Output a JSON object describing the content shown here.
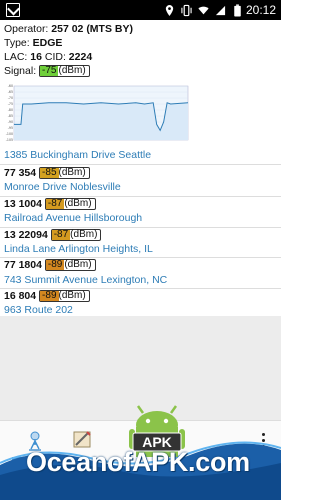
{
  "status_bar": {
    "time": "20:12"
  },
  "info": {
    "operator_label": "Operator:",
    "operator_value": "257 02 (MTS BY)",
    "type_label": "Type:",
    "type_value": "EDGE",
    "lac_label": "LAC:",
    "lac_value": "16",
    "cid_label": "CID:",
    "cid_value": "2224",
    "signal_label": "Signal:",
    "signal_value": "-75",
    "unit": "(dBm)"
  },
  "chart_data": {
    "type": "line",
    "y_ticks": [
      "-60",
      "-65",
      "-70",
      "-75",
      "-80",
      "-85",
      "-90",
      "-95",
      "-100",
      "-105"
    ],
    "ylim": [
      -105,
      -60
    ],
    "series": [
      {
        "x": [
          0,
          4,
          5,
          10,
          20,
          30,
          40,
          50,
          60,
          70,
          75,
          80,
          82,
          84,
          86,
          88,
          90,
          100
        ],
        "values": [
          -92,
          -92,
          -75,
          -75,
          -74,
          -74,
          -75,
          -74,
          -75,
          -74,
          -75,
          -74,
          -92,
          -97,
          -90,
          -74,
          -75,
          -74
        ]
      }
    ]
  },
  "cells": [
    {
      "address": "1385 Buckingham Drive Seattle"
    },
    {
      "id": "77 354",
      "signal": "-85",
      "unit": "(dBm)",
      "color": "#d4a220",
      "address": "Monroe Drive Noblesville"
    },
    {
      "id": "13 1004",
      "signal": "-87",
      "unit": "(dBm)",
      "color": "#d49a20",
      "address": "Railroad Avenue Hillsborough"
    },
    {
      "id": "13 22094",
      "signal": "-87",
      "unit": "(dBm)",
      "color": "#d49a20",
      "address": "Linda Lane Arlington Heights, IL"
    },
    {
      "id": "77 1804",
      "signal": "-89",
      "unit": "(dBm)",
      "color": "#d48820",
      "address": "743 Summit Avenue Lexington, NC"
    },
    {
      "id": "16 804",
      "signal": "-89",
      "unit": "(dBm)",
      "color": "#d48820",
      "address": "963 Route 202"
    }
  ],
  "colors": {
    "signal_good": "#6fcf3a",
    "accent": "#3f8fd0",
    "link": "#2e7db6"
  },
  "watermark": {
    "text": "OceanofAPK.com",
    "badge": "APK"
  }
}
